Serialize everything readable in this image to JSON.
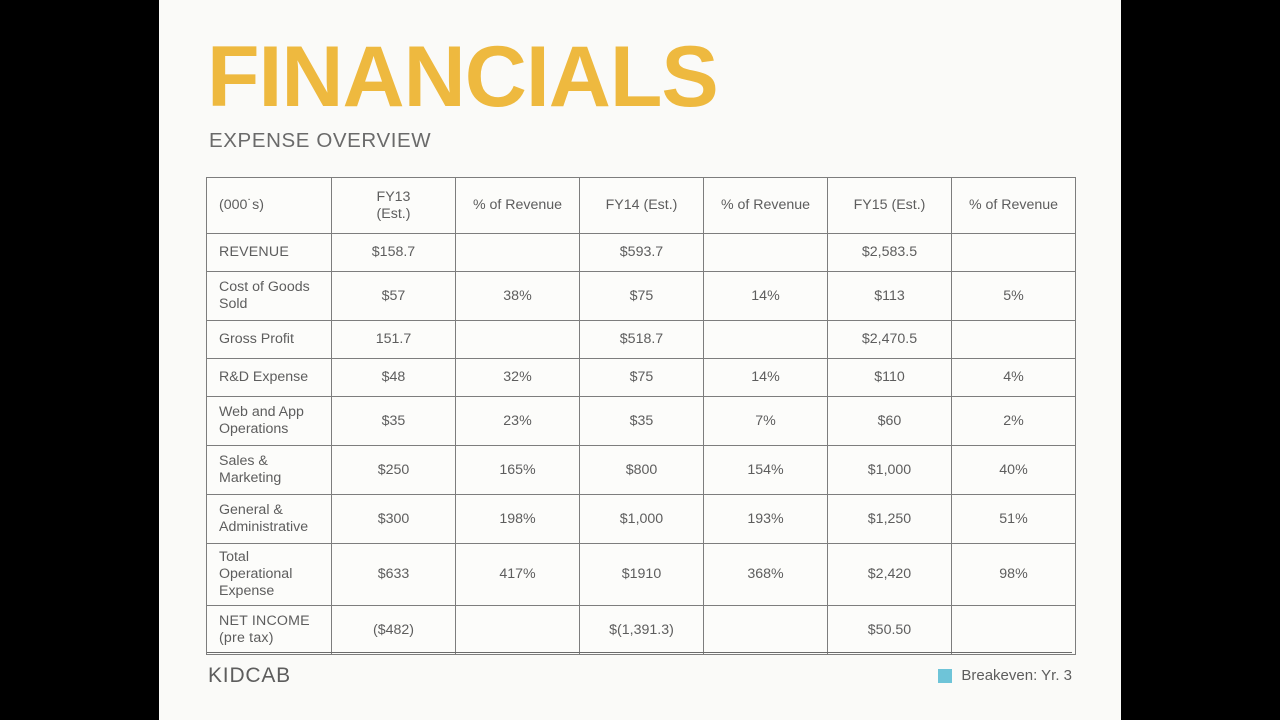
{
  "slide": {
    "title": "FINANCIALS",
    "subtitle": "EXPENSE OVERVIEW",
    "background_color": "#fafaf8",
    "title_color": "#eeb93f"
  },
  "colors": {
    "gold": "#f4c84f",
    "teal": "#62c0d6",
    "green_text": "#94a24f",
    "body_text": "#5d5d5d"
  },
  "table": {
    "headers": {
      "units": "(000˙s)",
      "fy13_line1": "FY13",
      "fy13_line2": "(Est.)",
      "pct1": "% of Revenue",
      "fy14": "FY14 (Est.)",
      "pct2": "% of Revenue",
      "fy15": "FY15  (Est.)",
      "pct3": "% of Revenue"
    },
    "rows": [
      {
        "label": "REVENUE",
        "label_lines": [
          "REVENUE"
        ],
        "fy13": "$158.7",
        "pct13": "",
        "fy14": "$593.7",
        "pct14": "",
        "fy15": "$2,583.5",
        "pct15": "",
        "style": "gold"
      },
      {
        "label": "Cost of Goods Sold",
        "label_lines": [
          "Cost of Goods",
          "Sold"
        ],
        "fy13": "$57",
        "pct13": "38%",
        "fy14": "$75",
        "pct14": "14%",
        "fy15": "$113",
        "pct15": "5%",
        "style": "normal"
      },
      {
        "label": "Gross Profit",
        "label_lines": [
          "Gross Profit"
        ],
        "fy13": "151.7",
        "pct13": "",
        "fy14": "$518.7",
        "pct14": "",
        "fy15": "$2,470.5",
        "pct15": "",
        "style": "normal"
      },
      {
        "label": "R&D Expense",
        "label_lines": [
          "R&D Expense"
        ],
        "fy13": "$48",
        "pct13": "32%",
        "fy14": "$75",
        "pct14": "14%",
        "fy15": "$110",
        "pct15": "4%",
        "style": "normal"
      },
      {
        "label": "Web and App Operations",
        "label_lines": [
          "Web and App",
          "Operations"
        ],
        "fy13": "$35",
        "pct13": "23%",
        "fy14": "$35",
        "pct14": "7%",
        "fy15": "$60",
        "pct15": "2%",
        "style": "normal"
      },
      {
        "label": "Sales & Marketing",
        "label_lines": [
          "Sales &",
          "Marketing"
        ],
        "fy13": "$250",
        "pct13": "165%",
        "fy14": "$800",
        "pct14": "154%",
        "fy15": "$1,000",
        "pct15": "40%",
        "style": "normal"
      },
      {
        "label": "General & Administrative",
        "label_lines": [
          "General &",
          "Administrative"
        ],
        "fy13": "$300",
        "pct13": "198%",
        "fy14": "$1,000",
        "pct14": "193%",
        "fy15": "$1,250",
        "pct15": "51%",
        "style": "normal"
      },
      {
        "label": "Total Operational Expense",
        "label_lines": [
          "Total",
          "Operational",
          "Expense"
        ],
        "fy13": "$633",
        "pct13": "417%",
        "fy14": "$1910",
        "pct14": "368%",
        "fy15": "$2,420",
        "pct15": "98%",
        "style": "normal"
      },
      {
        "label": "NET INCOME (pre tax)",
        "label_lines": [
          "NET INCOME",
          "(pre tax)"
        ],
        "fy13": "($482)",
        "pct13": "",
        "fy14": "$(1,391.3)",
        "pct14": "",
        "fy15": "$50.50",
        "pct15": "",
        "style": "gold",
        "fy15_highlight": "teal"
      }
    ]
  },
  "footer": {
    "brand": "KIDCAB",
    "legend_label": "Breakeven: Yr. 3",
    "legend_color": "#6ec4d8"
  }
}
